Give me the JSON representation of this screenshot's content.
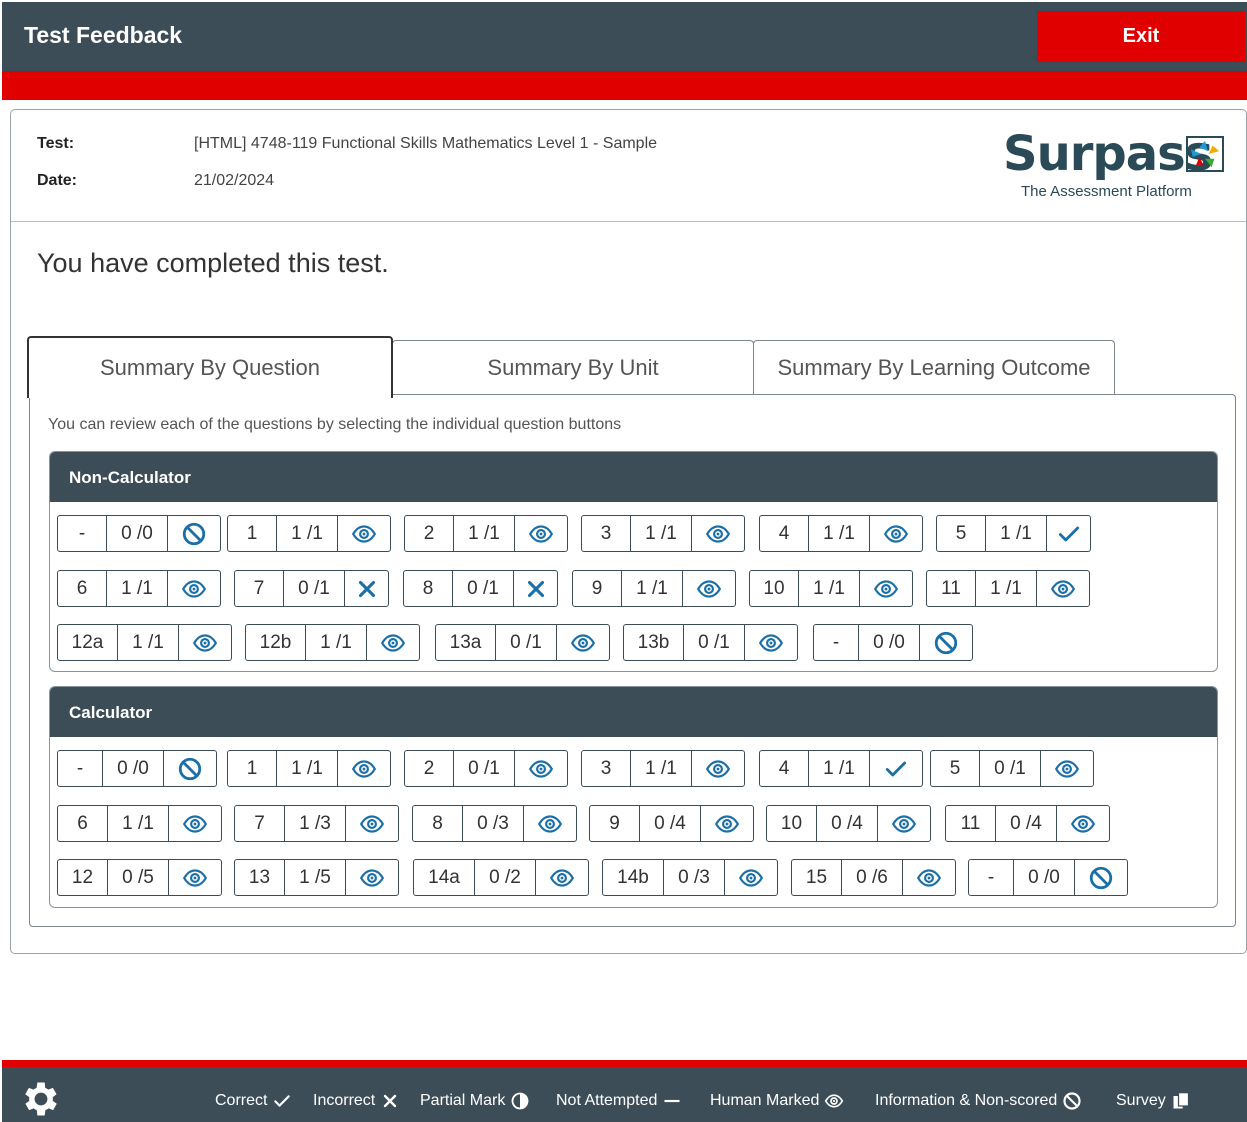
{
  "header": {
    "title": "Test Feedback",
    "exit_label": "Exit"
  },
  "meta": {
    "test_label": "Test:",
    "test_value": "[HTML] 4748-119 Functional Skills Mathematics Level 1 - Sample",
    "date_label": "Date:",
    "date_value": "21/02/2024"
  },
  "logo": {
    "word": "Surpass",
    "tagline": "The Assessment Platform"
  },
  "completed_text": "You have completed this test.",
  "tabs": [
    {
      "label": "Summary By Question",
      "active": true
    },
    {
      "label": "Summary By Unit",
      "active": false
    },
    {
      "label": "Summary By Learning Outcome",
      "active": false
    }
  ],
  "hint": "You can review each of the questions by selecting the individual question buttons",
  "sections": [
    {
      "title": "Non-Calculator",
      "questions": [
        {
          "num": "-",
          "score": "0 /0",
          "status": "info"
        },
        {
          "num": "1",
          "score": "1 /1",
          "status": "human"
        },
        {
          "num": "2",
          "score": "1 /1",
          "status": "human"
        },
        {
          "num": "3",
          "score": "1 /1",
          "status": "human"
        },
        {
          "num": "4",
          "score": "1 /1",
          "status": "human"
        },
        {
          "num": "5",
          "score": "1 /1",
          "status": "correct"
        },
        {
          "num": "6",
          "score": "1 /1",
          "status": "human"
        },
        {
          "num": "7",
          "score": "0 /1",
          "status": "incorrect"
        },
        {
          "num": "8",
          "score": "0 /1",
          "status": "incorrect"
        },
        {
          "num": "9",
          "score": "1 /1",
          "status": "human"
        },
        {
          "num": "10",
          "score": "1 /1",
          "status": "human"
        },
        {
          "num": "11",
          "score": "1 /1",
          "status": "human"
        },
        {
          "num": "12a",
          "score": "1 /1",
          "status": "human"
        },
        {
          "num": "12b",
          "score": "1 /1",
          "status": "human"
        },
        {
          "num": "13a",
          "score": "0 /1",
          "status": "human"
        },
        {
          "num": "13b",
          "score": "0 /1",
          "status": "human"
        },
        {
          "num": "-",
          "score": "0 /0",
          "status": "info"
        }
      ]
    },
    {
      "title": "Calculator",
      "questions": [
        {
          "num": "-",
          "score": "0 /0",
          "status": "info"
        },
        {
          "num": "1",
          "score": "1 /1",
          "status": "human"
        },
        {
          "num": "2",
          "score": "0 /1",
          "status": "human"
        },
        {
          "num": "3",
          "score": "1 /1",
          "status": "human"
        },
        {
          "num": "4",
          "score": "1 /1",
          "status": "correct"
        },
        {
          "num": "5",
          "score": "0 /1",
          "status": "human"
        },
        {
          "num": "6",
          "score": "1 /1",
          "status": "human"
        },
        {
          "num": "7",
          "score": "1 /3",
          "status": "human"
        },
        {
          "num": "8",
          "score": "0 /3",
          "status": "human"
        },
        {
          "num": "9",
          "score": "0 /4",
          "status": "human"
        },
        {
          "num": "10",
          "score": "0 /4",
          "status": "human"
        },
        {
          "num": "11",
          "score": "0 /4",
          "status": "human"
        },
        {
          "num": "12",
          "score": "0 /5",
          "status": "human"
        },
        {
          "num": "13",
          "score": "1 /5",
          "status": "human"
        },
        {
          "num": "14a",
          "score": "0 /2",
          "status": "human"
        },
        {
          "num": "14b",
          "score": "0 /3",
          "status": "human"
        },
        {
          "num": "15",
          "score": "0 /6",
          "status": "human"
        },
        {
          "num": "-",
          "score": "0 /0",
          "status": "info"
        }
      ]
    }
  ],
  "legend": [
    {
      "label": "Correct",
      "icon": "correct"
    },
    {
      "label": "Incorrect",
      "icon": "incorrect"
    },
    {
      "label": "Partial Mark",
      "icon": "partial"
    },
    {
      "label": "Not Attempted",
      "icon": "not-attempted"
    },
    {
      "label": "Human Marked",
      "icon": "human"
    },
    {
      "label": "Information & Non-scored",
      "icon": "info"
    },
    {
      "label": "Survey",
      "icon": "survey"
    }
  ],
  "colors": {
    "header_bg": "#3d4d57",
    "accent_red": "#e00000",
    "icon_blue": "#1a6fa8"
  }
}
